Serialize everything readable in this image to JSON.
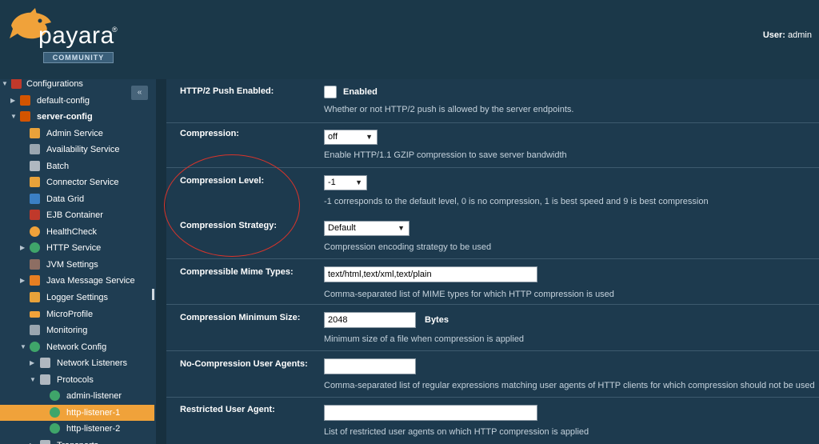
{
  "header": {
    "logo_word": "payara",
    "logo_reg": "®",
    "logo_badge": "COMMUNITY",
    "user_label": "User:",
    "user_name": "admin"
  },
  "sidebar": {
    "collapse_icon": "«",
    "items": [
      {
        "label": "Configurations",
        "icon": "config-folder-icon"
      },
      {
        "label": "default-config",
        "icon": "config-icon"
      },
      {
        "label": "server-config",
        "icon": "config-icon"
      },
      {
        "label": "Admin Service",
        "icon": "puzzle-icon"
      },
      {
        "label": "Availability Service",
        "icon": "availability-icon"
      },
      {
        "label": "Batch",
        "icon": "batch-icon"
      },
      {
        "label": "Connector Service",
        "icon": "puzzle-icon"
      },
      {
        "label": "Data Grid",
        "icon": "data-grid-icon"
      },
      {
        "label": "EJB Container",
        "icon": "ejb-icon"
      },
      {
        "label": "HealthCheck",
        "icon": "heart-icon"
      },
      {
        "label": "HTTP Service",
        "icon": "globe-icon"
      },
      {
        "label": "JVM Settings",
        "icon": "coffee-icon"
      },
      {
        "label": "Java Message Service",
        "icon": "jms-icon"
      },
      {
        "label": "Logger Settings",
        "icon": "puzzle-icon"
      },
      {
        "label": "MicroProfile",
        "icon": "microprofile-icon"
      },
      {
        "label": "Monitoring",
        "icon": "monitor-icon"
      },
      {
        "label": "Network Config",
        "icon": "globe-icon"
      },
      {
        "label": "Network Listeners",
        "icon": "folder-icon"
      },
      {
        "label": "Protocols",
        "icon": "folder-icon"
      },
      {
        "label": "admin-listener",
        "icon": "globe-icon"
      },
      {
        "label": "http-listener-1",
        "icon": "globe-icon"
      },
      {
        "label": "http-listener-2",
        "icon": "globe-icon"
      },
      {
        "label": "Transports",
        "icon": "folder-icon"
      }
    ]
  },
  "main": {
    "rows": [
      {
        "label": "HTTP/2 Push Enabled:",
        "control": "checkbox",
        "check_label": "Enabled",
        "help": "Whether or not HTTP/2 push is allowed by the server endpoints."
      },
      {
        "label": "Compression:",
        "control": "select",
        "value": "off",
        "help": "Enable HTTP/1.1 GZIP compression to save server bandwidth"
      },
      {
        "label": "Compression Level:",
        "control": "select",
        "value": "-1",
        "help": "-1 corresponds to the default level, 0 is no compression, 1 is best speed and 9 is best compression"
      },
      {
        "label": "Compression Strategy:",
        "control": "select",
        "value": "Default",
        "help": "Compression encoding strategy to be used"
      },
      {
        "label": "Compressible Mime Types:",
        "control": "text",
        "value": "text/html,text/xml,text/plain",
        "help": "Comma-separated list of MIME types for which HTTP compression is used"
      },
      {
        "label": "Compression Minimum Size:",
        "control": "text",
        "value": "2048",
        "unit": "Bytes",
        "help": "Minimum size of a file when compression is applied"
      },
      {
        "label": "No-Compression User Agents:",
        "control": "text",
        "value": "",
        "help": "Comma-separated list of regular expressions matching user agents of HTTP clients for which compression should not be used"
      },
      {
        "label": "Restricted User Agent:",
        "control": "text",
        "value": "",
        "help": "List of restricted user agents on which HTTP compression is applied"
      }
    ]
  },
  "colors": {
    "background": "#1d3a4e",
    "selected": "#f0a23a",
    "annotation": "#d9342b",
    "logo_orange": "#f0a23a"
  }
}
